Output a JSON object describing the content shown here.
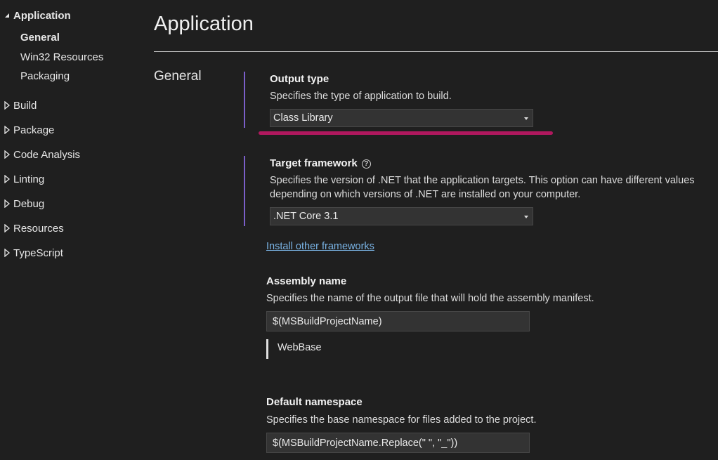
{
  "sidebar": {
    "application": {
      "label": "Application",
      "icon": "expanded-triangle-icon"
    },
    "sub_items": [
      {
        "label": "General",
        "selected": true
      },
      {
        "label": "Win32 Resources"
      },
      {
        "label": "Packaging"
      }
    ],
    "groups": [
      {
        "label": "Build",
        "icon": "collapsed-triangle-icon"
      },
      {
        "label": "Package",
        "icon": "collapsed-triangle-icon"
      },
      {
        "label": "Code Analysis",
        "icon": "collapsed-triangle-icon"
      },
      {
        "label": "Linting",
        "icon": "collapsed-triangle-icon"
      },
      {
        "label": "Debug",
        "icon": "collapsed-triangle-icon"
      },
      {
        "label": "Resources",
        "icon": "collapsed-triangle-icon"
      },
      {
        "label": "TypeScript",
        "icon": "collapsed-triangle-icon"
      }
    ]
  },
  "main": {
    "title": "Application",
    "section": "General",
    "output_type": {
      "title": "Output type",
      "description": "Specifies the type of application to build.",
      "value": "Class Library"
    },
    "target_framework": {
      "title": "Target framework",
      "help_icon": "?",
      "description_line1": "Specifies the version of .NET that the application targets. This option can have different values",
      "description_line2": "depending on which versions of .NET are installed on your computer.",
      "value": ".NET Core 3.1"
    },
    "install_link": "Install other frameworks",
    "assembly_name": {
      "title": "Assembly name",
      "description": "Specifies the name of the output file that will hold the assembly manifest.",
      "value": "$(MSBuildProjectName)",
      "preview": "WebBase"
    },
    "default_namespace": {
      "title": "Default namespace",
      "description": "Specifies the base namespace for files added to the project.",
      "value": "$(MSBuildProjectName.Replace(\" \", \"_\"))"
    }
  },
  "colors": {
    "background": "#1f1f1f",
    "accent_bar": "#7b5fc9",
    "highlight": "#b0185e",
    "link": "#7ab4e6"
  }
}
